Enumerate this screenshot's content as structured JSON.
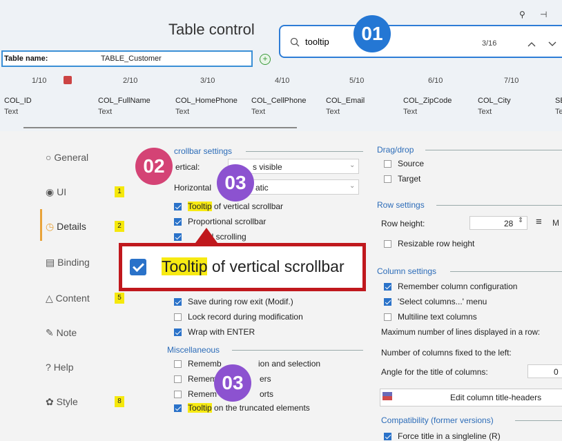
{
  "header": {
    "title": "Table control",
    "table_name_label": "Table name:",
    "table_name_value": "TABLE_Customer",
    "add_symbol": "+"
  },
  "search": {
    "value": "tooltip",
    "count": "3/16",
    "up": "^",
    "down": "v",
    "icon": "search-icon"
  },
  "window_icons": {
    "search": "⚲",
    "pin": "⊣"
  },
  "callouts": {
    "one": "01",
    "two": "02",
    "three_a": "03",
    "three_b": "03"
  },
  "columns": [
    {
      "num": "1/10",
      "name": "COL_ID",
      "type": "Text"
    },
    {
      "num": "2/10",
      "name": "COL_FullName",
      "type": "Text"
    },
    {
      "num": "3/10",
      "name": "COL_HomePhone",
      "type": "Text"
    },
    {
      "num": "4/10",
      "name": "COL_CellPhone",
      "type": "Text"
    },
    {
      "num": "5/10",
      "name": "COL_Email",
      "type": "Text"
    },
    {
      "num": "6/10",
      "name": "COL_ZipCode",
      "type": "Text"
    },
    {
      "num": "7/10",
      "name": "COL_City",
      "type": "Text"
    },
    {
      "num": "",
      "name": "SE",
      "type": "Te"
    }
  ],
  "sidebar": {
    "items": [
      {
        "label": "General",
        "icon": "radio-icon",
        "badge": ""
      },
      {
        "label": "UI",
        "icon": "eye-icon",
        "badge": "1"
      },
      {
        "label": "Details",
        "icon": "clock-icon",
        "badge": "2"
      },
      {
        "label": "Binding",
        "icon": "binding-icon",
        "badge": ""
      },
      {
        "label": "Content",
        "icon": "content-icon",
        "badge": "5"
      },
      {
        "label": "Note",
        "icon": "note-icon",
        "badge": ""
      },
      {
        "label": "Help",
        "icon": "help-icon",
        "badge": ""
      },
      {
        "label": "Style",
        "icon": "style-icon",
        "badge": "8"
      }
    ]
  },
  "scrollbar_settings": {
    "title": "Scrollbar settings",
    "title_visible": "crollbar settings",
    "vertical_label": "Vertical:",
    "vertical_label_visible": "ertical:",
    "vertical_value": "Always visible",
    "vertical_value_visible": "s visible",
    "horizontal_label": "Horizontal:",
    "horizontal_label_visible": "Horizontal",
    "horizontal_value": "Automatic",
    "horizontal_value_visible": "atic",
    "tooltip_hl": "Tooltip",
    "tooltip_rest": " of vertical scrollbar",
    "proportional": "Proportional scrollbar",
    "wheel_visible": "el scrolling"
  },
  "enlarged": {
    "hl": "Tooltip",
    "rest": " of vertical scrollbar"
  },
  "row_options": {
    "save_exit": "Save during row exit (Modif.)",
    "lock": "Lock record during modification",
    "wrap": "Wrap with ENTER"
  },
  "misc": {
    "title": "Miscellaneous",
    "remember1_a": "Rememb",
    "remember1_b": "ion and selection",
    "remember2_a": "Remem",
    "remember2_b": "ers",
    "remember3_a": "Remem",
    "remember3_b": "orts",
    "tooltip_hl": "Tooltip",
    "tooltip_rest": " on the truncated elements"
  },
  "dragdrop": {
    "title": "Drag/drop",
    "source": "Source",
    "target": "Target"
  },
  "row_settings": {
    "title": "Row settings",
    "height_label": "Row height:",
    "height_value": "28",
    "resizable": "Resizable row height"
  },
  "column_settings": {
    "title": "Column settings",
    "remember": "Remember column configuration",
    "select_menu": "'Select columns...' menu",
    "multiline": "Multiline text columns",
    "max_lines": "Maximum number of lines displayed in a row:",
    "fixed_left": "Number of columns fixed to the left:",
    "angle": "Angle for the title of columns:",
    "angle_value": "0",
    "edit_button": "Edit column title-headers"
  },
  "compat": {
    "title": "Compatibility (former versions)",
    "force": "Force title in a singleline (R)"
  }
}
